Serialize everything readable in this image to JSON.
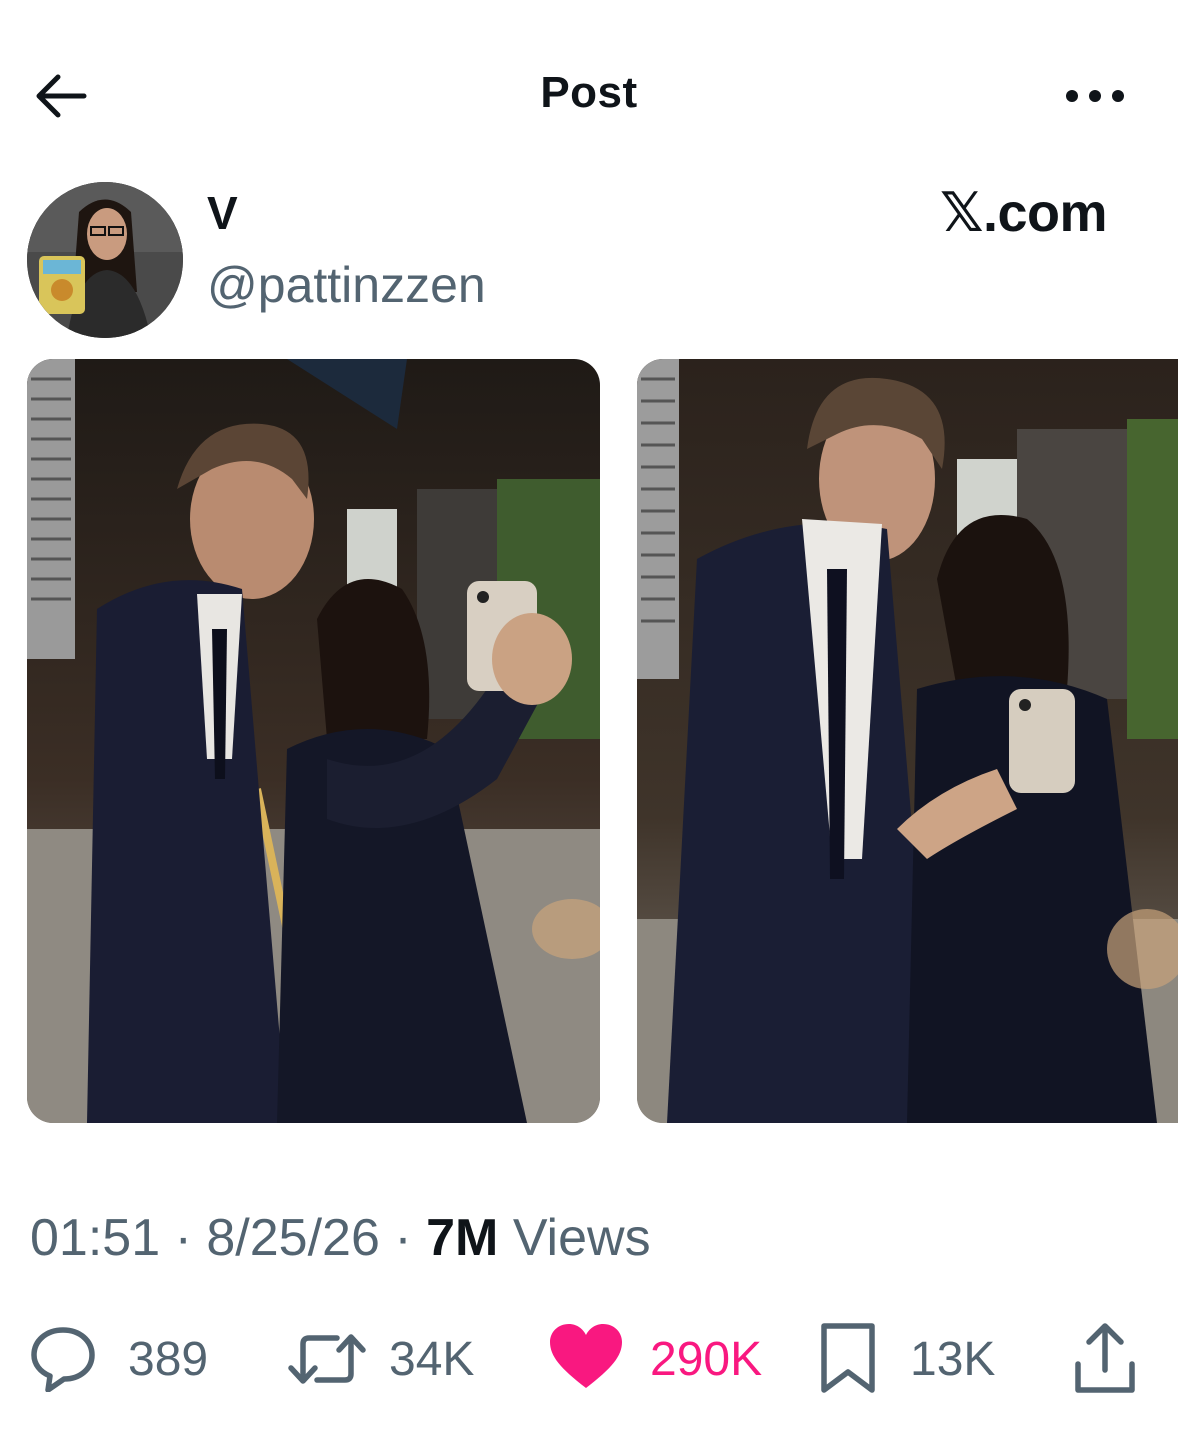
{
  "header": {
    "title": "Post",
    "back_icon": "arrow-left-icon",
    "more_icon": "more-horizontal-icon"
  },
  "author": {
    "display_name": "V",
    "handle": "@pattinzzen"
  },
  "watermark": "𝕏.com",
  "media": [
    {
      "description": "selfie-photo-1"
    },
    {
      "description": "selfie-photo-2"
    }
  ],
  "meta": {
    "time": "01:51",
    "date": "8/25/26",
    "views_count": "7M",
    "views_label": "Views",
    "separator": "·"
  },
  "actions": {
    "replies": "389",
    "reposts": "34K",
    "likes": "290K",
    "bookmarks": "13K"
  },
  "colors": {
    "text_primary": "#0f1419",
    "text_secondary": "#536471",
    "like_active": "#f91880"
  }
}
